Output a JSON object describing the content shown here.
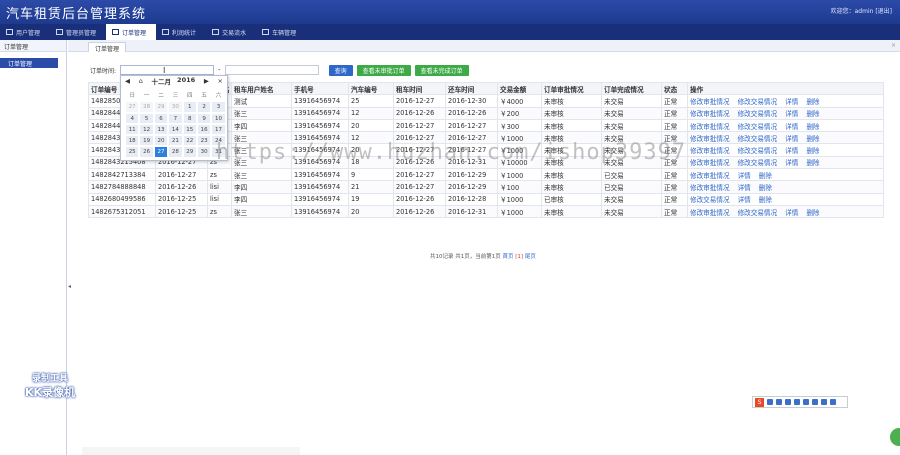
{
  "header": {
    "title": "汽车租赁后台管理系统",
    "userinfo": "欢迎您：admin [退出]"
  },
  "nav": [
    {
      "label": "用户管理",
      "icon": "home-icon"
    },
    {
      "label": "管理员管理",
      "icon": "grid-icon"
    },
    {
      "label": "订单管理",
      "icon": "grid-icon",
      "active": true
    },
    {
      "label": "利润统计",
      "icon": "grid-icon"
    },
    {
      "label": "交易流水",
      "icon": "grid-icon"
    },
    {
      "label": "车辆管理",
      "icon": "grid-icon"
    }
  ],
  "sidebar": {
    "head": "订单管理",
    "items": [
      "订单管理"
    ]
  },
  "tabs": {
    "active": "订单管理",
    "close": "×"
  },
  "search": {
    "label": "订单时间:",
    "query_btn": "查询",
    "unapproved_btn": "查看未审批订单",
    "unfinished_btn": "查看未完成订单"
  },
  "calendar": {
    "month": "十二月",
    "year": "2016",
    "weekdays": [
      "日",
      "一",
      "二",
      "三",
      "四",
      "五",
      "六"
    ],
    "days": [
      "27",
      "28",
      "29",
      "30",
      "1",
      "2",
      "3",
      "4",
      "5",
      "6",
      "7",
      "8",
      "9",
      "10",
      "11",
      "12",
      "13",
      "14",
      "15",
      "16",
      "17",
      "18",
      "19",
      "20",
      "21",
      "22",
      "23",
      "24",
      "25",
      "26",
      "27",
      "28",
      "29",
      "30",
      "31"
    ],
    "today_index": 30
  },
  "table": {
    "headers": [
      "订单编号",
      "下单时间",
      "用户名",
      "租车用户姓名",
      "手机号",
      "汽车编号",
      "租车时间",
      "还车时间",
      "交易金额",
      "订单审批情况",
      "订单完成情况",
      "状态",
      "操作"
    ],
    "rows": [
      [
        "1482850",
        "",
        "",
        "测试",
        "13916456974",
        "25",
        "2016-12-27",
        "2016-12-30",
        "￥4000",
        "未审核",
        "未交易",
        "正常"
      ],
      [
        "1482844",
        "",
        "",
        "张三",
        "13916456974",
        "12",
        "2016-12-26",
        "2016-12-26",
        "￥200",
        "未审核",
        "未交易",
        "正常"
      ],
      [
        "1482844",
        "",
        "",
        "李四",
        "13916456974",
        "20",
        "2016-12-27",
        "2016-12-27",
        "￥300",
        "未审核",
        "未交易",
        "正常"
      ],
      [
        "1482843",
        "",
        "",
        "张三",
        "13916456974",
        "12",
        "2016-12-27",
        "2016-12-27",
        "￥1000",
        "未审核",
        "未交易",
        "正常"
      ],
      [
        "1482843289819",
        "2016-12-27",
        "zs",
        "张三",
        "13916456974",
        "20",
        "2016-12-27",
        "2016-12-27",
        "￥1000",
        "未审核",
        "未交易",
        "正常"
      ],
      [
        "1482843215408",
        "2016-12-27",
        "zs",
        "张三",
        "13916456974",
        "18",
        "2016-12-26",
        "2016-12-31",
        "￥10000",
        "未审核",
        "未交易",
        "正常"
      ],
      [
        "1482842713384",
        "2016-12-27",
        "zs",
        "张三",
        "13916456974",
        "9",
        "2016-12-27",
        "2016-12-29",
        "￥1000",
        "未审核",
        "已交易",
        "正常"
      ],
      [
        "1482784888848",
        "2016-12-26",
        "lisi",
        "李四",
        "13916456974",
        "21",
        "2016-12-27",
        "2016-12-29",
        "￥100",
        "未审核",
        "已交易",
        "正常"
      ],
      [
        "1482680499586",
        "2016-12-25",
        "lisi",
        "李四",
        "13916456974",
        "19",
        "2016-12-26",
        "2016-12-28",
        "￥1000",
        "已审核",
        "未交易",
        "正常"
      ],
      [
        "1482675312051",
        "2016-12-25",
        "zs",
        "张三",
        "13916456974",
        "20",
        "2016-12-26",
        "2016-12-31",
        "￥1000",
        "未审核",
        "未交易",
        "正常"
      ]
    ],
    "actions": [
      [
        "修改审批情况",
        "修改交易情况",
        "详情",
        "删除"
      ],
      [
        "修改审批情况",
        "修改交易情况",
        "详情",
        "删除"
      ],
      [
        "修改审批情况",
        "修改交易情况",
        "详情",
        "删除"
      ],
      [
        "修改审批情况",
        "修改交易情况",
        "详情",
        "删除"
      ],
      [
        "修改审批情况",
        "修改交易情况",
        "详情",
        "删除"
      ],
      [
        "修改审批情况",
        "修改交易情况",
        "详情",
        "删除"
      ],
      [
        "修改审批情况",
        "详情",
        "删除"
      ],
      [
        "修改审批情况",
        "详情",
        "删除"
      ],
      [
        "修改交易情况",
        "详情",
        "删除"
      ],
      [
        "修改审批情况",
        "修改交易情况",
        "详情",
        "删除"
      ]
    ]
  },
  "pager": {
    "summary": "共10记录 共1页，当前第1页",
    "first": "首页",
    "current": "[1]",
    "last": "尾页"
  },
  "watermark": "https://www.huzhan.com/ishop39397",
  "rec_logo": {
    "line1": "录制工具",
    "line2": "KK录像机"
  },
  "colors": {
    "header": "#1e3a8f",
    "accent": "#2d67c9",
    "green": "#3eaa47",
    "today": "#2d80e0"
  }
}
